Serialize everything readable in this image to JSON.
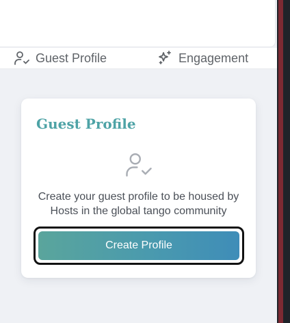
{
  "nav": {
    "items": [
      {
        "label": "Guest Profile",
        "icon": "user-check-icon"
      },
      {
        "label": "Engagement",
        "icon": "sparkles-icon"
      }
    ]
  },
  "card": {
    "title": "Guest Profile",
    "icon": "user-check-icon",
    "description": "Create your guest profile to be housed by Hosts in the global tango community",
    "button_label": "Create Profile"
  },
  "colors": {
    "title": "#4ea3a6",
    "button_gradient_start": "#5aa59c",
    "button_gradient_end": "#3f8db8",
    "nav_text": "#5f6368",
    "window_edge": "#7c2a33"
  }
}
